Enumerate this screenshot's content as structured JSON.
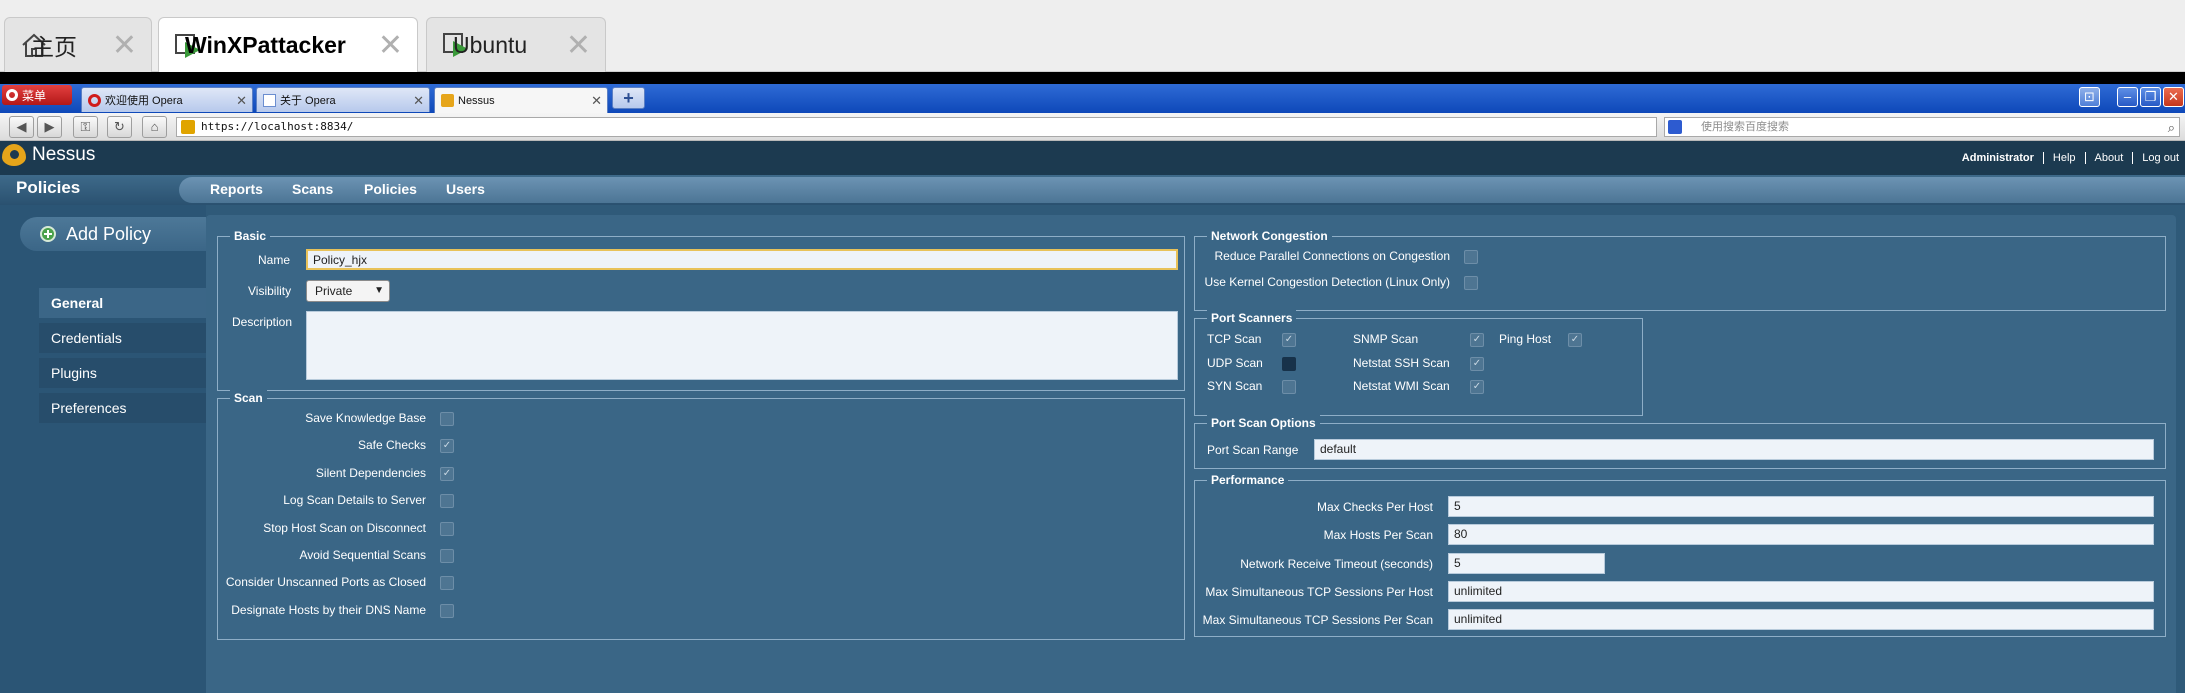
{
  "vm_tabs": [
    {
      "label": "主页"
    },
    {
      "label": "WinXPattacker"
    },
    {
      "label": "Ubuntu"
    }
  ],
  "opera": {
    "menu_label": "菜单",
    "tabs": [
      {
        "label": "欢迎使用 Opera"
      },
      {
        "label": "关于 Opera"
      },
      {
        "label": "Nessus"
      }
    ],
    "url": "https://localhost:8834/",
    "search_placeholder": "使用搜索百度搜索"
  },
  "nessus": {
    "brand": "Nessus",
    "user": "Administrator",
    "links": [
      "Help",
      "About",
      "Log out"
    ],
    "page_title": "Policies",
    "nav": [
      "Reports",
      "Scans",
      "Policies",
      "Users"
    ],
    "add_policy": "Add Policy",
    "left_menu": [
      "General",
      "Credentials",
      "Plugins",
      "Preferences"
    ]
  },
  "basic": {
    "legend": "Basic",
    "name_label": "Name",
    "name_value": "Policy_hjx",
    "visibility_label": "Visibility",
    "visibility_value": "Private",
    "description_label": "Description",
    "description_value": ""
  },
  "scan": {
    "legend": "Scan",
    "options": [
      {
        "label": "Save Knowledge Base",
        "checked": false
      },
      {
        "label": "Safe Checks",
        "checked": true
      },
      {
        "label": "Silent Dependencies",
        "checked": true
      },
      {
        "label": "Log Scan Details to Server",
        "checked": false
      },
      {
        "label": "Stop Host Scan on Disconnect",
        "checked": false
      },
      {
        "label": "Avoid Sequential Scans",
        "checked": false
      },
      {
        "label": "Consider Unscanned Ports as Closed",
        "checked": false
      },
      {
        "label": "Designate Hosts by their DNS Name",
        "checked": false
      }
    ]
  },
  "network": {
    "legend": "Network Congestion",
    "options": [
      {
        "label": "Reduce Parallel Connections on Congestion",
        "checked": false
      },
      {
        "label": "Use Kernel Congestion Detection (Linux Only)",
        "checked": false
      }
    ]
  },
  "port_scanners": {
    "legend": "Port Scanners",
    "items": [
      {
        "label": "TCP Scan",
        "checked": true
      },
      {
        "label": "UDP Scan",
        "checked": false
      },
      {
        "label": "SYN Scan",
        "checked": false
      },
      {
        "label": "SNMP Scan",
        "checked": true
      },
      {
        "label": "Netstat SSH Scan",
        "checked": true
      },
      {
        "label": "Netstat WMI Scan",
        "checked": true
      },
      {
        "label": "Ping Host",
        "checked": true
      }
    ]
  },
  "port_scan_options": {
    "legend": "Port Scan Options",
    "range_label": "Port Scan Range",
    "range_value": "default"
  },
  "performance": {
    "legend": "Performance",
    "fields": [
      {
        "label": "Max Checks Per Host",
        "value": "5"
      },
      {
        "label": "Max Hosts Per Scan",
        "value": "80"
      },
      {
        "label": "Network Receive Timeout (seconds)",
        "value": "5"
      },
      {
        "label": "Max Simultaneous TCP Sessions Per Host",
        "value": "unlimited"
      },
      {
        "label": "Max Simultaneous TCP Sessions Per Scan",
        "value": "unlimited"
      }
    ]
  }
}
